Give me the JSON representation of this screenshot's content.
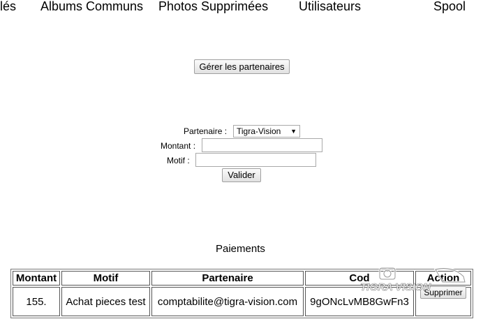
{
  "nav": {
    "items": [
      {
        "label": "lés"
      },
      {
        "label": "Albums Communs"
      },
      {
        "label": "Photos Supprimées"
      },
      {
        "label": "Utilisateurs"
      },
      {
        "label": "Spool"
      }
    ]
  },
  "partners_button": "Gérer les partenaires",
  "form": {
    "partner_label": "Partenaire :",
    "partner_selected": "Tigra-Vision",
    "amount_label": "Montant :",
    "amount_value": "",
    "reason_label": "Motif :",
    "reason_value": "",
    "submit_label": "Valider"
  },
  "payments": {
    "title": "Paiements",
    "headers": [
      "Montant",
      "Motif",
      "Partenaire",
      "Cod",
      "Action"
    ],
    "rows": [
      {
        "amount": "155.",
        "reason": "Achat pieces test",
        "partner": "comptabilite@tigra-vision.com",
        "code": "9gONcLvMB8GwFn3",
        "action": "Supprimer"
      }
    ]
  },
  "watermark": {
    "text": "TIGRA VISION",
    "icon": "camera-icon"
  }
}
